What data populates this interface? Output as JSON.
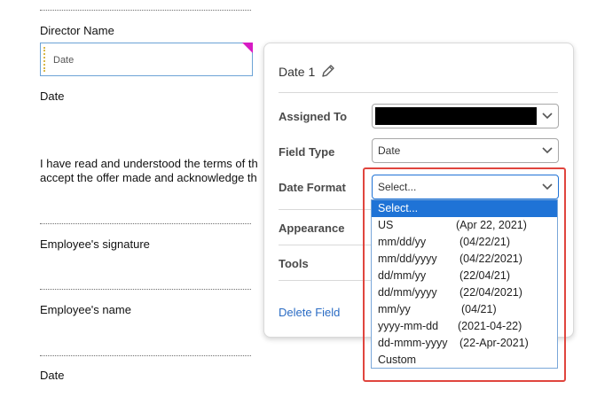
{
  "document": {
    "director_name_label": "Director Name",
    "date_field_placeholder": "Date",
    "date_label_1": "Date",
    "terms_line_1": "I have read and understood the terms of th",
    "terms_line_2": "accept the offer made and acknowledge th",
    "employee_signature_label": "Employee's signature",
    "employee_name_label": "Employee's name",
    "date_label_2": "Date"
  },
  "panel": {
    "title": "Date 1",
    "assigned_to_label": "Assigned To",
    "field_type_label": "Field Type",
    "field_type_value": "Date",
    "date_format_label": "Date Format",
    "date_format_value": "Select...",
    "appearance_label": "Appearance",
    "tools_label": "Tools",
    "delete_label": "Delete Field"
  },
  "date_format_options": [
    {
      "name": "Select...",
      "example": ""
    },
    {
      "name": "US",
      "example": "(Apr 22, 2021)"
    },
    {
      "name": "mm/dd/yy",
      "example": "(04/22/21)"
    },
    {
      "name": "mm/dd/yyyy",
      "example": "(04/22/2021)"
    },
    {
      "name": "dd/mm/yy",
      "example": "(22/04/21)"
    },
    {
      "name": "dd/mm/yyyy",
      "example": "(22/04/2021)"
    },
    {
      "name": "mm/yy",
      "example": "(04/21)"
    },
    {
      "name": "yyyy-mm-dd",
      "example": "(2021-04-22)"
    },
    {
      "name": "dd-mmm-yyyy",
      "example": "(22-Apr-2021)"
    },
    {
      "name": "Custom",
      "example": ""
    }
  ],
  "colors": {
    "selected_option": "#1f73d6",
    "highlight_box": "#e0453e",
    "link": "#2b6cc4",
    "field_corner": "#d71bc4"
  },
  "icons": [
    "pencil-icon",
    "chevron-down-icon"
  ]
}
